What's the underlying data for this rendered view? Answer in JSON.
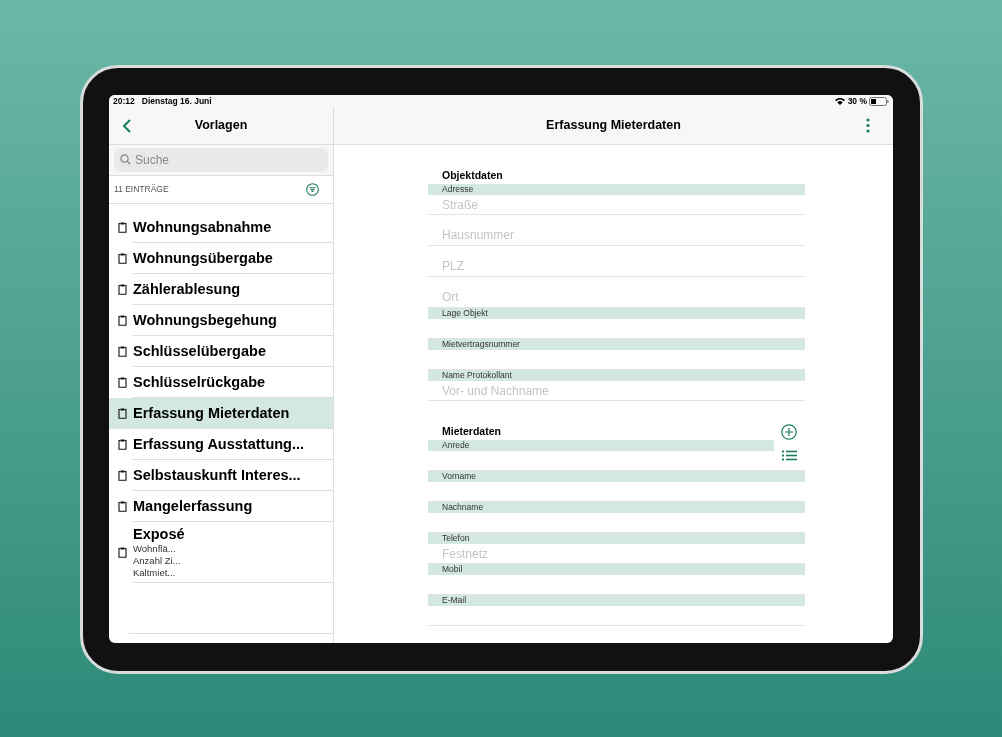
{
  "status_bar": {
    "time": "20:12",
    "date": "Dienstag 16. Juni",
    "battery": "30 %"
  },
  "sidebar": {
    "title": "Vorlagen",
    "search": {
      "placeholder": "Suche"
    },
    "count": "11 EINTRÄGE",
    "items": [
      {
        "title": "Wohnungsabnahme",
        "selected": false
      },
      {
        "title": "Wohnungsübergabe",
        "selected": false
      },
      {
        "title": "Zählerablesung",
        "selected": false
      },
      {
        "title": "Wohnungsbegehung",
        "selected": false
      },
      {
        "title": "Schlüsselübergabe",
        "selected": false
      },
      {
        "title": "Schlüsselrückgabe",
        "selected": false
      },
      {
        "title": "Erfassung Mieterdaten",
        "selected": true
      },
      {
        "title": "Erfassung Ausstattung...",
        "selected": false
      },
      {
        "title": "Selbstauskunft Interes...",
        "selected": false
      },
      {
        "title": "Mangelerfassung",
        "selected": false
      },
      {
        "title": "Exposé",
        "selected": false,
        "details": [
          "Wohnflä...",
          "Anzahl Zi...",
          "Kaltmiet..."
        ]
      }
    ]
  },
  "main": {
    "title": "Erfassung Mieterdaten",
    "form": [
      {
        "kind": "section",
        "text": "Objektdaten"
      },
      {
        "kind": "label",
        "text": "Adresse"
      },
      {
        "kind": "field",
        "placeholder": "Straße"
      },
      {
        "kind": "field",
        "placeholder": "Hausnummer"
      },
      {
        "kind": "field",
        "placeholder": "PLZ"
      },
      {
        "kind": "field",
        "placeholder": "Ort"
      },
      {
        "kind": "label",
        "text": "Lage Objekt"
      },
      {
        "kind": "field"
      },
      {
        "kind": "label",
        "text": "Mietvertragsnummer"
      },
      {
        "kind": "field"
      },
      {
        "kind": "label",
        "text": "Name Protokollant"
      },
      {
        "kind": "field",
        "placeholder": "Vor- und Nachname"
      },
      {
        "kind": "spacer"
      },
      {
        "kind": "section",
        "text": "Mieterdaten",
        "add_button": true
      },
      {
        "kind": "label",
        "text": "Anrede",
        "list_button": true
      },
      {
        "kind": "field"
      },
      {
        "kind": "label",
        "text": "Vorname"
      },
      {
        "kind": "field"
      },
      {
        "kind": "label",
        "text": "Nachname"
      },
      {
        "kind": "field"
      },
      {
        "kind": "label",
        "text": "Telefon"
      },
      {
        "kind": "field",
        "placeholder": "Festnetz"
      },
      {
        "kind": "label",
        "text": "Mobil"
      },
      {
        "kind": "field"
      },
      {
        "kind": "label",
        "text": "E-Mail"
      },
      {
        "kind": "field"
      }
    ]
  }
}
